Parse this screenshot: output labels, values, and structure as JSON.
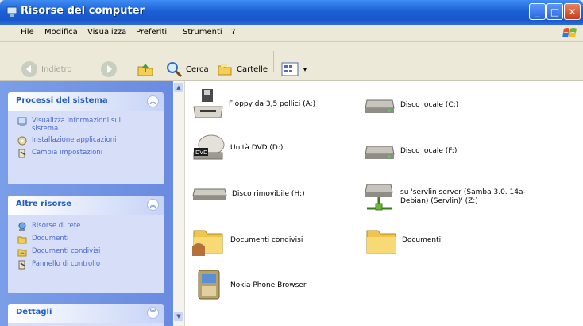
{
  "window": {
    "title": "Risorse del computer"
  },
  "menu": [
    "File",
    "Modifica",
    "Visualizza",
    "Preferiti",
    "Strumenti",
    "?"
  ],
  "toolbar": {
    "back": "Indietro",
    "search": "Cerca",
    "folders": "Cartelle"
  },
  "sidebar": {
    "groups": [
      {
        "title": "Processi del sistema",
        "tasks": [
          "Visualizza informazioni sul sistema",
          "Installazione applicazioni",
          "Cambia impostazioni"
        ]
      },
      {
        "title": "Altre risorse",
        "tasks": [
          "Risorse di rete",
          "Documenti",
          "Documenti condivisi",
          "Pannello di controllo"
        ]
      },
      {
        "title": "Dettagli",
        "tasks": []
      }
    ]
  },
  "items": [
    {
      "label": "Floppy da 3,5 pollici (A:)",
      "icon": "floppy-drive-icon"
    },
    {
      "label": "Disco locale (C:)",
      "icon": "hard-disk-icon"
    },
    {
      "label": "Unità DVD (D:)",
      "icon": "dvd-drive-icon"
    },
    {
      "label": "Disco locale (F:)",
      "icon": "hard-disk-icon"
    },
    {
      "label": "Disco rimovibile (H:)",
      "icon": "removable-disk-icon"
    },
    {
      "label": "su 'servlin server (Samba 3.0. 14a-Debian) (Servlin)' (Z:)",
      "icon": "network-drive-icon"
    },
    {
      "label": "Documenti condivisi",
      "icon": "shared-folder-icon"
    },
    {
      "label": "Documenti",
      "icon": "folder-icon"
    },
    {
      "label": "Nokia Phone Browser",
      "icon": "phone-browser-icon"
    }
  ],
  "colors": {
    "titlebar": "#1b5fd6",
    "sidebar": "#6a8be0",
    "link": "#215dc6",
    "close": "#c93d17"
  }
}
